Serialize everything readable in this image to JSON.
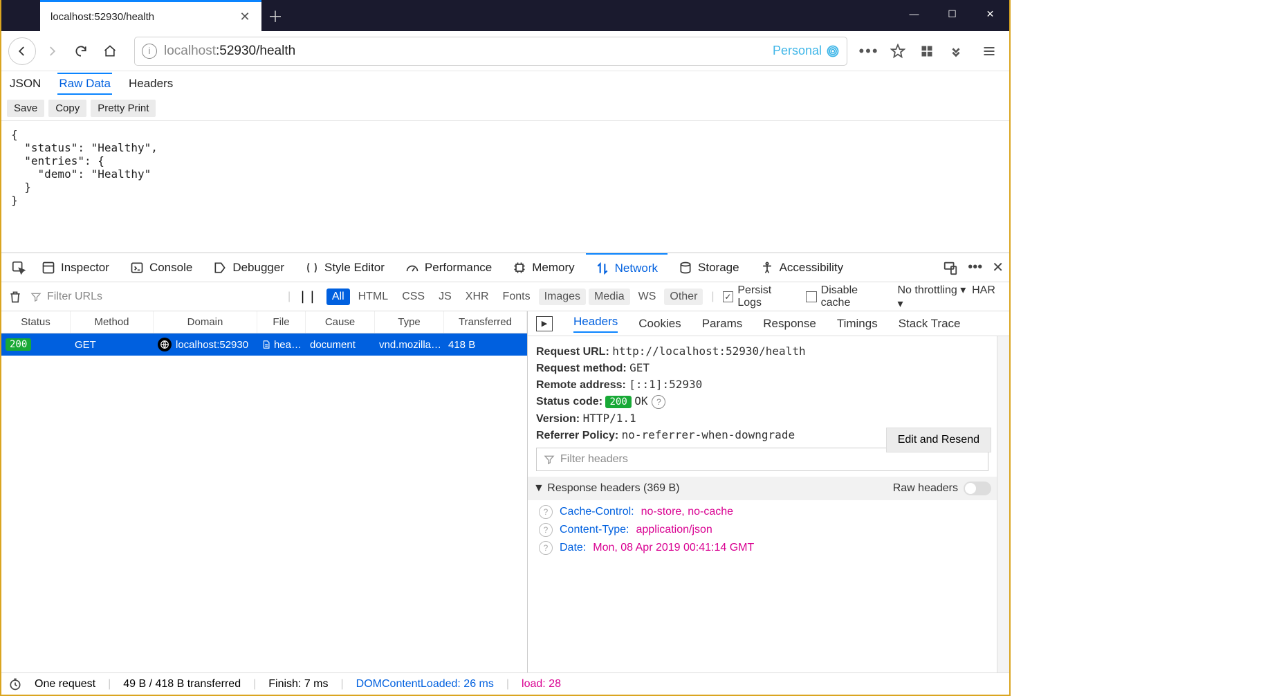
{
  "tab": {
    "title": "localhost:52930/health"
  },
  "url": {
    "scheme_host": "localhost",
    "rest": ":52930/health"
  },
  "container_label": "Personal",
  "json_tabs": [
    "JSON",
    "Raw Data",
    "Headers"
  ],
  "json_tabs_active": 1,
  "json_toolbar": {
    "save": "Save",
    "copy": "Copy",
    "pretty": "Pretty Print"
  },
  "json_body": "{\n  \"status\": \"Healthy\",\n  \"entries\": {\n    \"demo\": \"Healthy\"\n  }\n}",
  "devtools_tabs": [
    "Inspector",
    "Console",
    "Debugger",
    "Style Editor",
    "Performance",
    "Memory",
    "Network",
    "Storage",
    "Accessibility"
  ],
  "devtools_active": 6,
  "filter_urls_placeholder": "Filter URLs",
  "filter_types": [
    "All",
    "HTML",
    "CSS",
    "JS",
    "XHR",
    "Fonts",
    "Images",
    "Media",
    "WS",
    "Other"
  ],
  "persist_label": "Persist Logs",
  "disable_cache_label": "Disable cache",
  "throttling_label": "No throttling",
  "har_label": "HAR",
  "net_columns": [
    "Status",
    "Method",
    "Domain",
    "File",
    "Cause",
    "Type",
    "Transferred"
  ],
  "net_row": {
    "status": "200",
    "method": "GET",
    "domain": "localhost:52930",
    "file": "hea…",
    "cause": "document",
    "type": "vnd.mozilla…",
    "transferred": "418 B"
  },
  "detail_tabs": [
    "Headers",
    "Cookies",
    "Params",
    "Response",
    "Timings",
    "Stack Trace"
  ],
  "detail_active": 0,
  "summary": {
    "request_url_label": "Request URL:",
    "request_url": "http://localhost:52930/health",
    "request_method_label": "Request method:",
    "request_method": "GET",
    "remote_addr_label": "Remote address:",
    "remote_addr": "[::1]:52930",
    "status_code_label": "Status code:",
    "status_code": "200",
    "status_text": "OK",
    "version_label": "Version:",
    "version": "HTTP/1.1",
    "referrer_label": "Referrer Policy:",
    "referrer": "no-referrer-when-downgrade"
  },
  "edit_resend_label": "Edit and Resend",
  "filter_headers_placeholder": "Filter headers",
  "response_headers_label": "Response headers (369 B)",
  "raw_headers_label": "Raw headers",
  "response_headers": [
    {
      "name": "Cache-Control:",
      "value": "no-store, no-cache"
    },
    {
      "name": "Content-Type:",
      "value": "application/json"
    },
    {
      "name": "Date:",
      "value": "Mon, 08 Apr 2019 00:41:14 GMT"
    }
  ],
  "status_bar": {
    "requests": "One request",
    "transferred": "49 B / 418 B transferred",
    "finish": "Finish: 7 ms",
    "dcl": "DOMContentLoaded: 26 ms",
    "load": "load: 28"
  }
}
